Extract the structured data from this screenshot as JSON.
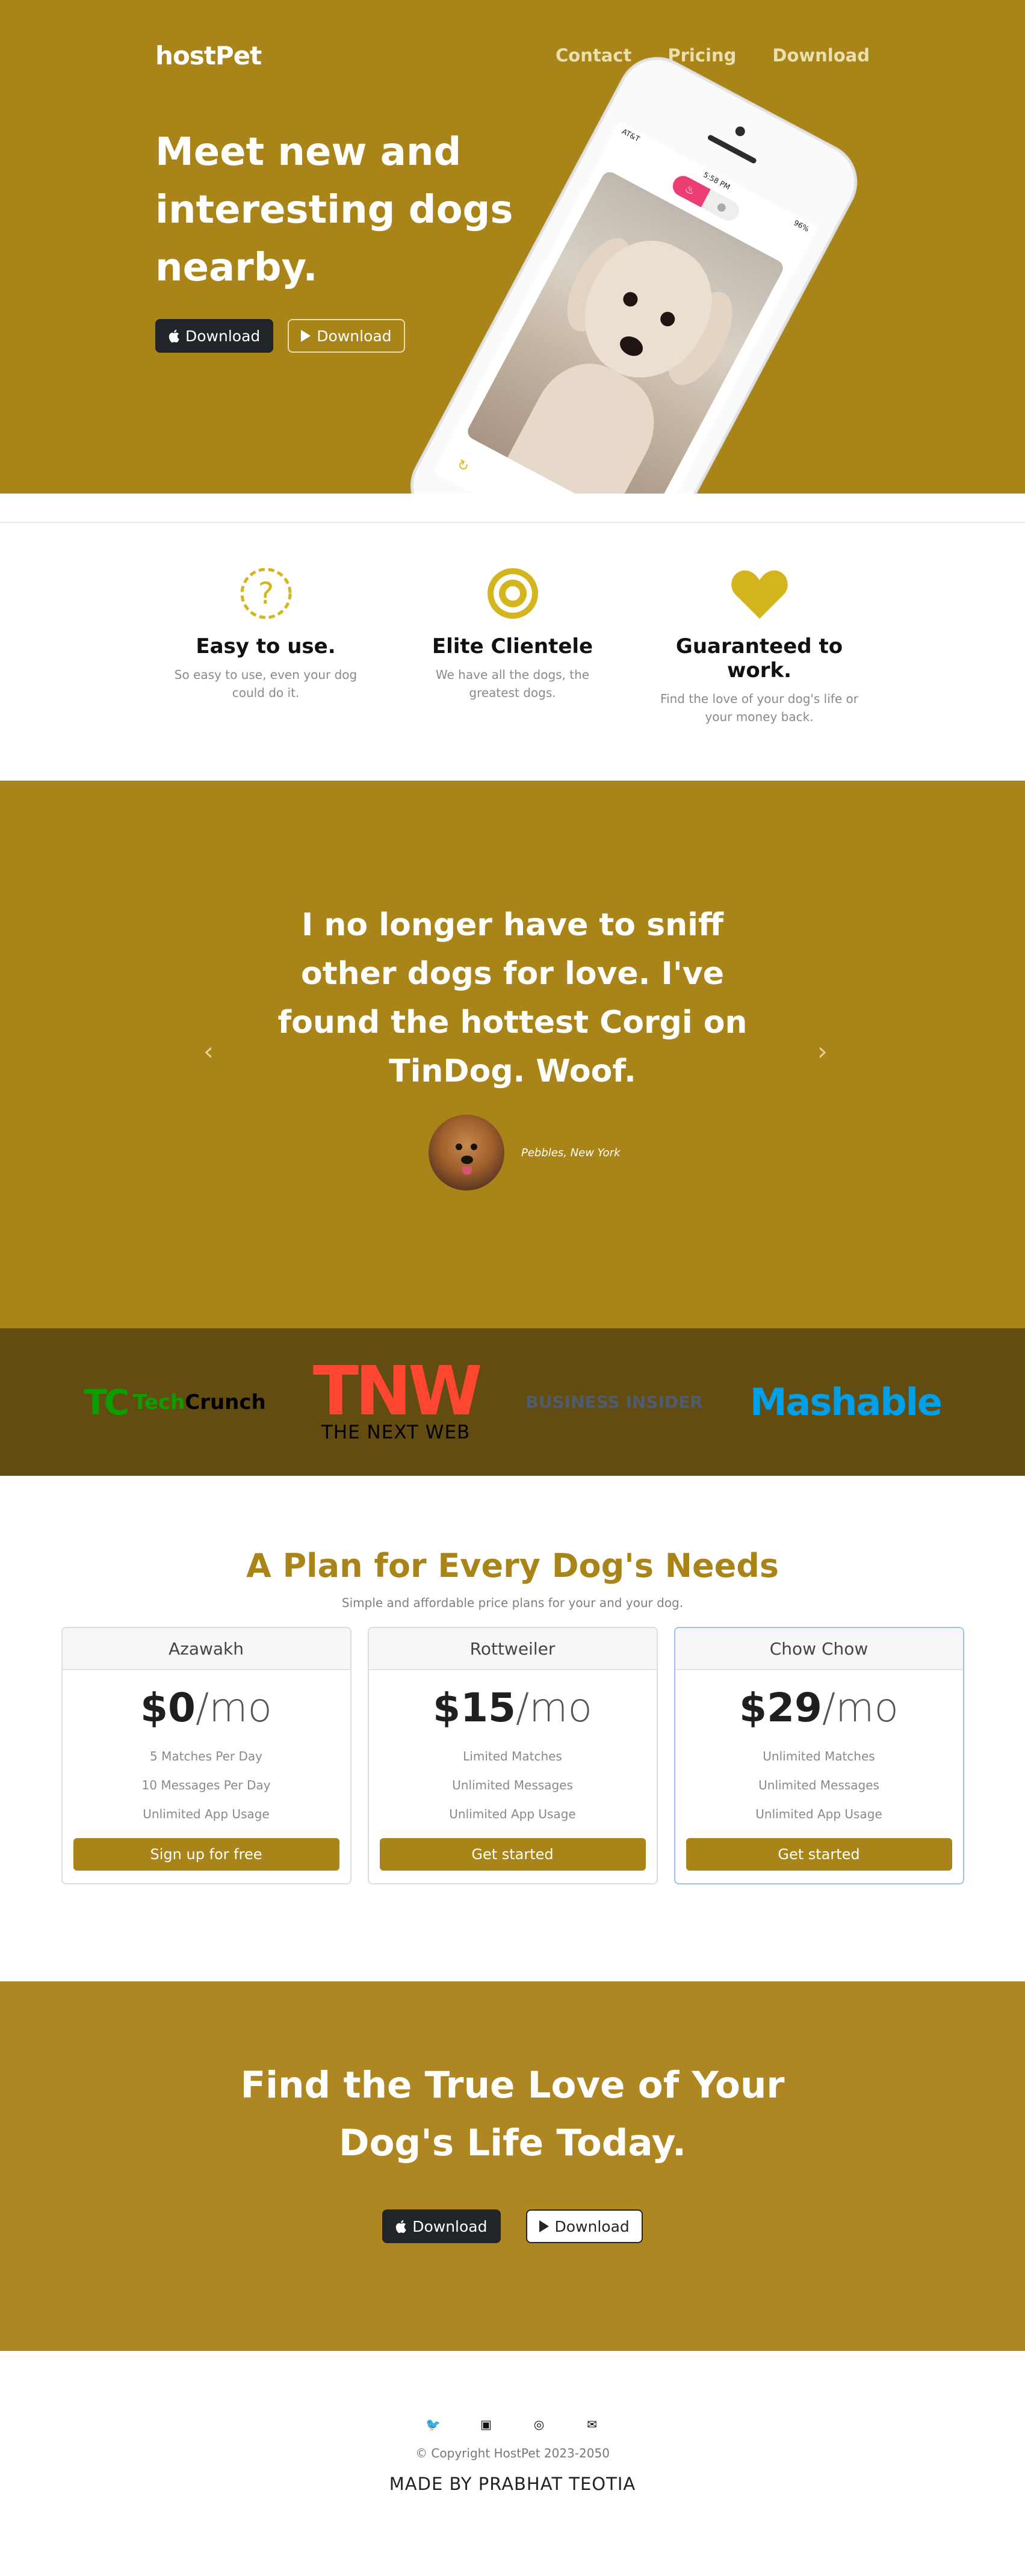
{
  "nav": {
    "brand": "hostPet",
    "links": [
      "Contact",
      "Pricing",
      "Download"
    ]
  },
  "hero": {
    "title": "Meet new and interesting dogs nearby.",
    "buttons": [
      {
        "label": "Download",
        "icon": "apple-icon"
      },
      {
        "label": "Download",
        "icon": "play-icon"
      }
    ],
    "phone": {
      "carrier": "AT&T",
      "time": "5:58 PM",
      "battery": "96%"
    }
  },
  "features": [
    {
      "icon": "question-circle-icon",
      "title": "Easy to use.",
      "desc": "So easy to use, even your dog could do it."
    },
    {
      "icon": "bullseye-icon",
      "title": "Elite Clientele",
      "desc": "We have all the dogs, the greatest dogs."
    },
    {
      "icon": "heart-icon",
      "title": "Guaranteed to work.",
      "desc": "Find the love of your dog's life or your money back."
    }
  ],
  "testimonial": {
    "quote": "I no longer have to sniff other dogs for love. I've found the hottest Corgi on TinDog. Woof.",
    "name": "Pebbles, New York"
  },
  "press": {
    "techcrunch": {
      "mark": "TC",
      "tech": "Tech",
      "crunch": "Crunch"
    },
    "tnw": {
      "big": "TNW",
      "small": "THE NEXT WEB"
    },
    "bi": "BUSINESS INSIDER",
    "mashable": "Mashable"
  },
  "pricing": {
    "title": "A Plan for Every Dog's Needs",
    "subtitle": "Simple and affordable price plans for your and your dog.",
    "plans": [
      {
        "name": "Azawakh",
        "price": "$0",
        "unit": "/mo",
        "features": [
          "5 Matches Per Day",
          "10 Messages Per Day",
          "Unlimited App Usage"
        ],
        "button": "Sign up for free"
      },
      {
        "name": "Rottweiler",
        "price": "$15",
        "unit": "/mo",
        "features": [
          "Limited Matches",
          "Unlimited Messages",
          "Unlimited App Usage"
        ],
        "button": "Get started"
      },
      {
        "name": "Chow Chow",
        "price": "$29",
        "unit": "/mo",
        "features": [
          "Unlimited Matches",
          "Unlimited Messages",
          "Unlimited App Usage"
        ],
        "button": "Get started"
      }
    ]
  },
  "cta": {
    "title": "Find the True Love of Your Dog's Life Today.",
    "buttons": [
      "Download",
      "Download"
    ]
  },
  "footer": {
    "social": [
      "twitter-icon",
      "twitch-icon",
      "instagram-icon",
      "mail-icon"
    ],
    "copyright": "© Copyright HostPet 2023-2050",
    "made_by": "MADE BY PRABHAT TEOTIA"
  },
  "colors": {
    "brand": "#a88419",
    "press_bg": "#634c12",
    "icon_gold": "#d4b51e"
  }
}
